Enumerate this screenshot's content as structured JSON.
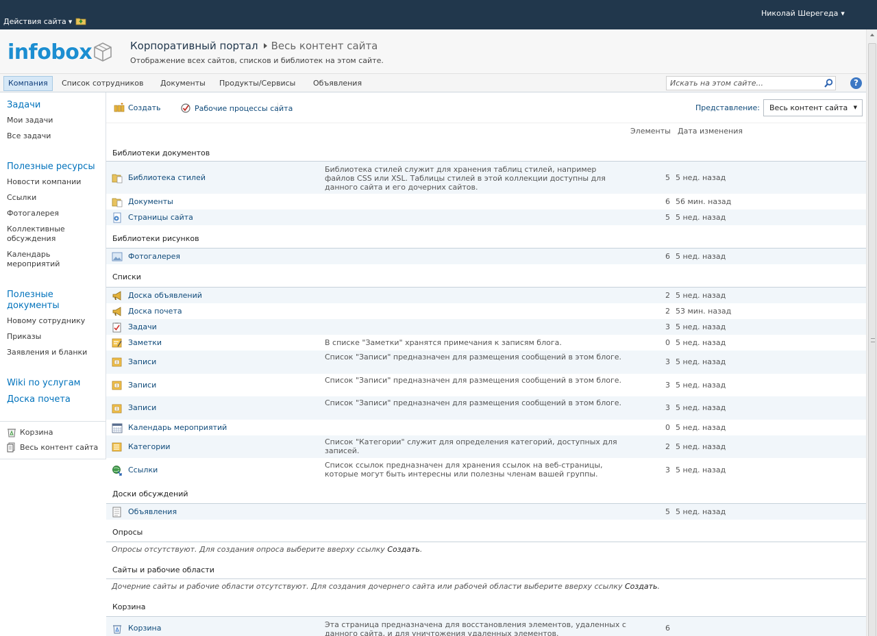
{
  "topbar": {
    "site_actions": "Действия сайта",
    "user": "Николай Шерегеда"
  },
  "header": {
    "logo": "infobox",
    "breadcrumb_root": "Корпоративный портал",
    "breadcrumb_current": "Весь контент сайта",
    "description": "Отображение всех сайтов, списков и библиотек на этом сайте."
  },
  "topnav": {
    "tabs": [
      "Компания",
      "Список сотрудников",
      "Документы",
      "Продукты/Сервисы",
      "Объявления"
    ],
    "search_placeholder": "Искать на этом сайте..."
  },
  "leftnav": {
    "tasks_head": "Задачи",
    "tasks": [
      "Мои задачи",
      "Все задачи"
    ],
    "resources_head": "Полезные ресурсы",
    "resources": [
      "Новости компании",
      "Ссылки",
      "Фотогалерея",
      "Коллективные обсуждения",
      "Календарь мероприятий"
    ],
    "docs_head": "Полезные документы",
    "docs": [
      "Новому сотруднику",
      "Приказы",
      "Заявления и бланки"
    ],
    "wiki": "Wiki по услугам",
    "honor": "Доска почета",
    "recycle": "Корзина",
    "all_content": "Весь контент сайта"
  },
  "toolbar": {
    "create": "Создать",
    "workflows": "Рабочие процессы сайта",
    "view_label": "Представление:",
    "view_value": "Весь контент сайта"
  },
  "columns": {
    "items": "Элементы",
    "modified": "Дата изменения"
  },
  "sections": {
    "doc_libraries": {
      "title": "Библиотеки документов",
      "rows": [
        {
          "name": "Библиотека стилей",
          "desc": "Библиотека стилей служит для хранения таблиц стилей, например файлов CSS или XSL. Таблицы стилей в этой коллекции доступны для данного сайта и его дочерних сайтов.",
          "count": "5",
          "date": "5 нед. назад"
        },
        {
          "name": "Документы",
          "desc": "",
          "count": "6",
          "date": "56 мин. назад"
        },
        {
          "name": "Страницы сайта",
          "desc": "",
          "count": "5",
          "date": "5 нед. назад"
        }
      ]
    },
    "picture_libraries": {
      "title": "Библиотеки рисунков",
      "rows": [
        {
          "name": "Фотогалерея",
          "desc": "",
          "count": "6",
          "date": "5 нед. назад"
        }
      ]
    },
    "lists": {
      "title": "Списки",
      "rows": [
        {
          "name": "Доска объявлений",
          "desc": "",
          "count": "2",
          "date": "5 нед. назад"
        },
        {
          "name": "Доска почета",
          "desc": "",
          "count": "2",
          "date": "53 мин. назад"
        },
        {
          "name": "Задачи",
          "desc": "",
          "count": "3",
          "date": "5 нед. назад"
        },
        {
          "name": "Заметки",
          "desc": "В списке \"Заметки\" хранятся примечания к записям блога.",
          "count": "0",
          "date": "5 нед. назад"
        },
        {
          "name": "Записи",
          "desc": "Список \"Записи\" предназначен для размещения сообщений в этом блоге.",
          "count": "3",
          "date": "5 нед. назад"
        },
        {
          "name": "Записи",
          "desc": "Список \"Записи\" предназначен для размещения сообщений в этом блоге.",
          "count": "3",
          "date": "5 нед. назад"
        },
        {
          "name": "Записи",
          "desc": "Список \"Записи\" предназначен для размещения сообщений в этом блоге.",
          "count": "3",
          "date": "5 нед. назад"
        },
        {
          "name": "Календарь мероприятий",
          "desc": "",
          "count": "0",
          "date": "5 нед. назад"
        },
        {
          "name": "Категории",
          "desc": "Список \"Категории\" служит для определения категорий, доступных для записей.",
          "count": "2",
          "date": "5 нед. назад"
        },
        {
          "name": "Ссылки",
          "desc": "Список ссылок предназначен для хранения ссылок на веб-страницы, которые могут быть интересны или полезны членам вашей группы.",
          "count": "3",
          "date": "5 нед. назад"
        }
      ]
    },
    "discussions": {
      "title": "Доски обсуждений",
      "rows": [
        {
          "name": "Объявления",
          "desc": "",
          "count": "5",
          "date": "5 нед. назад"
        }
      ]
    },
    "surveys": {
      "title": "Опросы",
      "empty_text": "Опросы отсутствуют. Для создания опроса выберите вверху ссылку ",
      "empty_link": "Создать",
      "empty_end": "."
    },
    "sites": {
      "title": "Сайты и рабочие области",
      "empty_text": "Дочерние сайты и рабочие области отсутствуют. Для создания дочернего сайта или рабочей области выберите вверху ссылку ",
      "empty_link": "Создать",
      "empty_end": "."
    },
    "recycle": {
      "title": "Корзина",
      "rows": [
        {
          "name": "Корзина",
          "desc": "Эта страница предназначена для восстановления элементов, удаленных с данного сайта, и для уничтожения удаленных элементов.",
          "count": "6",
          "date": ""
        }
      ]
    }
  },
  "colors": {
    "topbar": "#21374c",
    "link": "#0f4a7a",
    "logo": "#1c8ed1",
    "alt_row": "#f1f6fa"
  }
}
